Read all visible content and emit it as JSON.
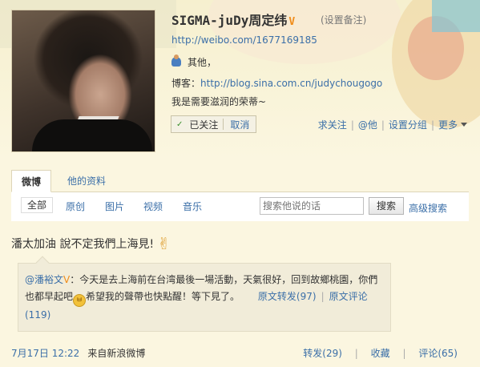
{
  "profile": {
    "name": "SIGMA-juDy周定纬",
    "verified_mark": "V",
    "remark_link": "(设置备注)",
    "url": "http://weibo.com/1677169185",
    "location": "其他，",
    "blog_label": "博客：",
    "blog_url": "http://blog.sina.com.cn/judychougogo",
    "bio": "我是需要滋润的荣蒂~"
  },
  "follow": {
    "check": "✓",
    "followed_label": "已关注",
    "cancel_label": "取消"
  },
  "actions": {
    "recommend": "求关注",
    "at": "@他",
    "group": "设置分组",
    "more": "更多"
  },
  "tabs": [
    {
      "label": "微博",
      "active": true
    },
    {
      "label": "他的资料",
      "active": false
    }
  ],
  "filters": [
    "全部",
    "原创",
    "图片",
    "视频",
    "音乐"
  ],
  "search": {
    "placeholder": "搜索他说的话",
    "button": "搜索",
    "advanced": "高级搜索"
  },
  "post": {
    "text": "潘太加油 說不定我們上海見!",
    "emoji": "✌",
    "repost": {
      "author": "@潘裕文",
      "author_badge": "V",
      "text_part1": "：今天是去上海前在台湾最後一場活動，天氣很好，回到故鄉桃園，你們也都早起吧",
      "emoji_face": "ㅂ",
      "text_part2": "希望我的聲帶也快點醒！等下見了。",
      "original_repost": "原文转发(97)",
      "separator": "|",
      "original_comment": "原文评论(119)"
    },
    "time": "7月17日 12:22",
    "source": "来自新浪微博",
    "repost_count": "转发(29)",
    "favorite": "收藏",
    "comment_count": "评论(65)",
    "separator": "|"
  }
}
